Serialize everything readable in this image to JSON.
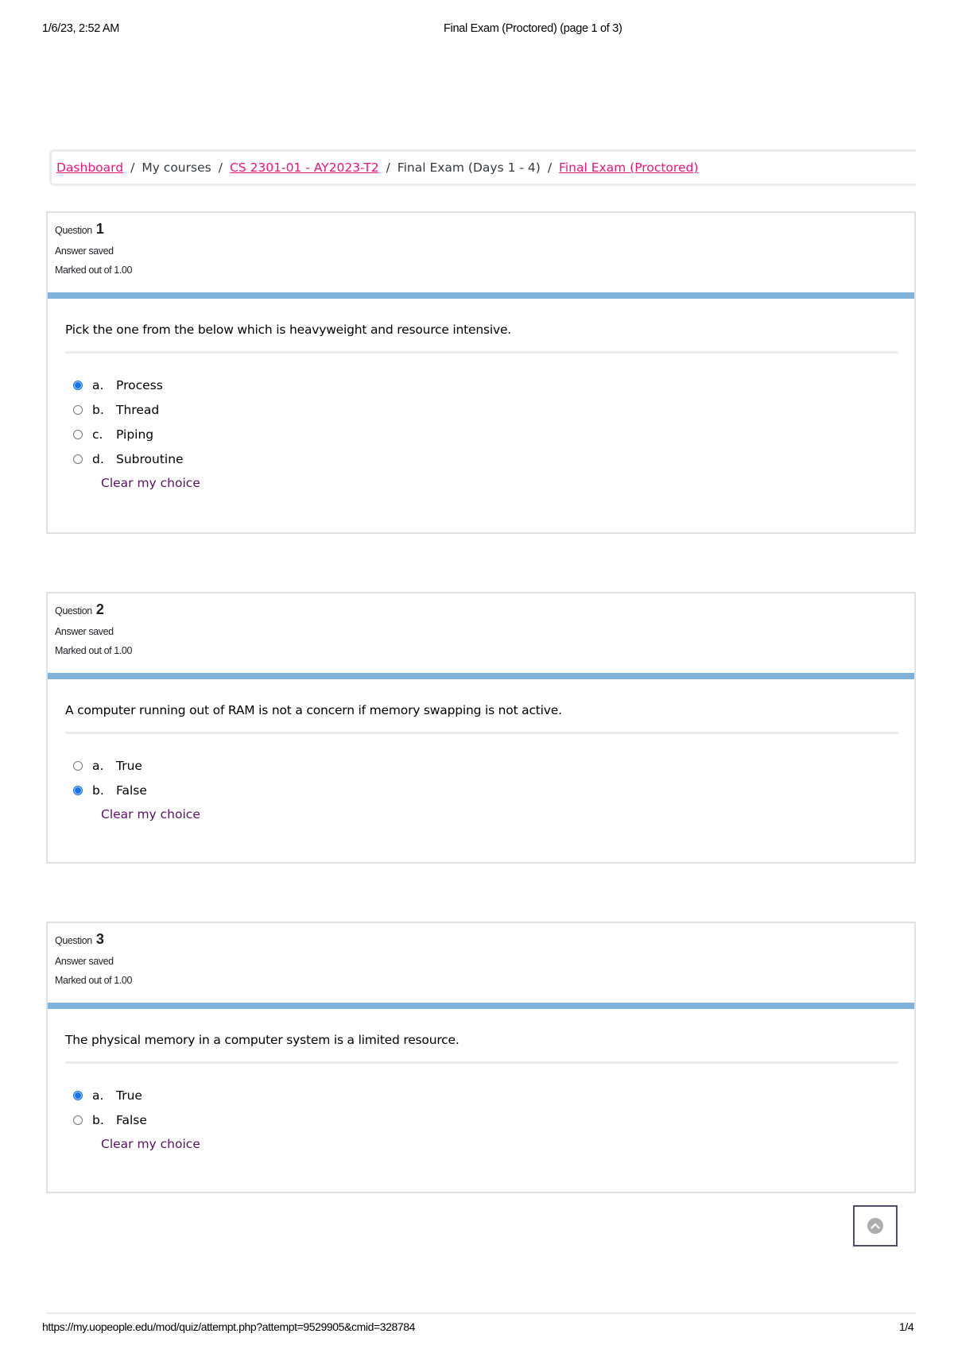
{
  "print_header": {
    "datetime": "1/6/23, 2:52 AM",
    "title": "Final Exam (Proctored) (page 1 of 3)"
  },
  "breadcrumb": [
    {
      "label": "Dashboard",
      "link": true
    },
    {
      "label": "My courses",
      "link": false
    },
    {
      "label": "CS 2301-01 - AY2023-T2",
      "link": true
    },
    {
      "label": "Final Exam (Days 1 - 4)",
      "link": false
    },
    {
      "label": "Final Exam (Proctored)",
      "link": true
    }
  ],
  "breadcrumb_separator": "/",
  "colors": {
    "link": "#e8157c",
    "clear_choice": "#5b1066",
    "accent_bar": "#7fb3dc",
    "radio_checked": "#1a73e8"
  },
  "questions": [
    {
      "label": "Question",
      "number": "1",
      "status": "Answer saved",
      "marks": "Marked out of 1.00",
      "text": "Pick the one from the below which is heavyweight and resource intensive.",
      "options": [
        {
          "letter": "a.",
          "text": "Process",
          "selected": true
        },
        {
          "letter": "b.",
          "text": "Thread",
          "selected": false
        },
        {
          "letter": "c.",
          "text": "Piping",
          "selected": false
        },
        {
          "letter": "d.",
          "text": "Subroutine",
          "selected": false
        }
      ],
      "clear_label": "Clear my choice"
    },
    {
      "label": "Question",
      "number": "2",
      "status": "Answer saved",
      "marks": "Marked out of 1.00",
      "text": "A computer running out of RAM is not a concern if memory swapping is not active.",
      "options": [
        {
          "letter": "a.",
          "text": "True",
          "selected": false
        },
        {
          "letter": "b.",
          "text": "False",
          "selected": true
        }
      ],
      "clear_label": "Clear my choice"
    },
    {
      "label": "Question",
      "number": "3",
      "status": "Answer saved",
      "marks": "Marked out of 1.00",
      "text": "The physical memory in a computer system is a limited resource.",
      "options": [
        {
          "letter": "a.",
          "text": "True",
          "selected": true
        },
        {
          "letter": "b.",
          "text": "False",
          "selected": false
        }
      ],
      "clear_label": "Clear my choice"
    }
  ],
  "back_to_top": {
    "icon": "chevron-up-circle-icon"
  },
  "print_footer": {
    "url": "https://my.uopeople.edu/mod/quiz/attempt.php?attempt=9529905&cmid=328784",
    "page": "1/4"
  }
}
